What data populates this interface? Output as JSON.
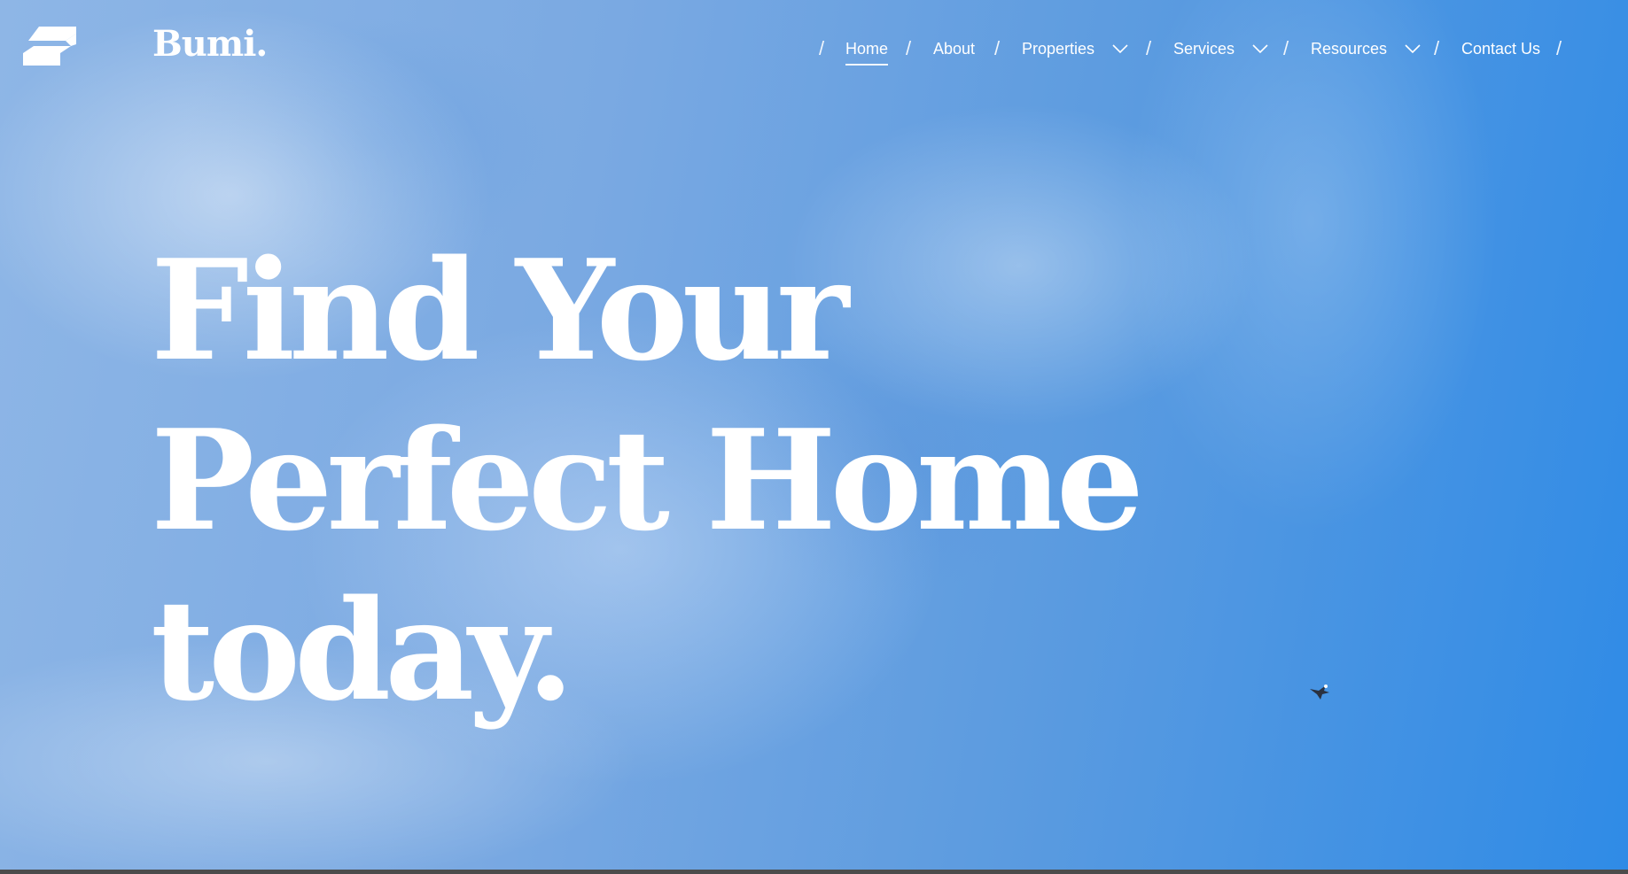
{
  "brand": {
    "name": "Bumi.",
    "logo_icon": "stacked-shape-logo-icon"
  },
  "nav": {
    "items": [
      {
        "label": "Home",
        "active": true,
        "dropdown": false
      },
      {
        "label": "About",
        "active": false,
        "dropdown": false
      },
      {
        "label": "Properties",
        "active": false,
        "dropdown": true
      },
      {
        "label": "Services",
        "active": false,
        "dropdown": true
      },
      {
        "label": "Resources",
        "active": false,
        "dropdown": true
      },
      {
        "label": "Contact Us",
        "active": false,
        "dropdown": false
      }
    ],
    "separator": "/"
  },
  "hero": {
    "lines": [
      "Find Your",
      "Perfect Home",
      "today."
    ]
  },
  "colors": {
    "text": "#ffffff",
    "sky_light": "#8eb6e6",
    "sky_deep": "#2f8be6",
    "frame_border": "#4c4c4c"
  }
}
